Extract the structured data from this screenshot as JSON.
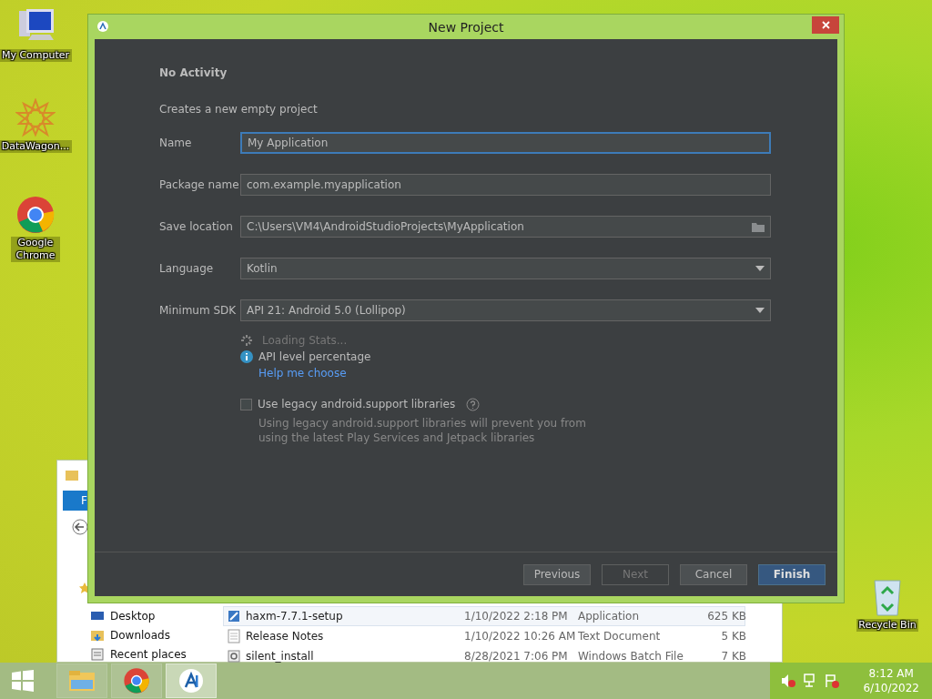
{
  "desktop_icons": [
    {
      "kind": "computer",
      "label": "My Computer"
    },
    {
      "kind": "star",
      "label": "DataWagon..."
    },
    {
      "kind": "browser",
      "label": "Google Chrome"
    }
  ],
  "recycle_bin": {
    "label": "Recycle Bin"
  },
  "explorer": {
    "ribbon_tab": "F",
    "nav_items": [
      {
        "kind": "desktop",
        "label": "Desktop"
      },
      {
        "kind": "downloads",
        "label": "Downloads"
      },
      {
        "kind": "recent",
        "label": "Recent places"
      }
    ],
    "files": [
      {
        "kind": "app",
        "name": "haxm-7.7.1-setup",
        "date": "1/10/2022 2:18 PM",
        "type": "Application",
        "size": "625 KB",
        "selected": true
      },
      {
        "kind": "text",
        "name": "Release Notes",
        "date": "1/10/2022 10:26 AM",
        "type": "Text Document",
        "size": "5 KB",
        "selected": false
      },
      {
        "kind": "batch",
        "name": "silent_install",
        "date": "8/28/2021 7:06 PM",
        "type": "Windows Batch File",
        "size": "7 KB",
        "selected": false
      }
    ]
  },
  "dialog": {
    "title": "New Project",
    "heading": "No Activity",
    "description": "Creates a new empty project",
    "fields": [
      {
        "kind": "text",
        "label": "Name",
        "value": "My Application",
        "focused": true
      },
      {
        "kind": "text",
        "label": "Package name",
        "value": "com.example.myapplication",
        "focused": false
      },
      {
        "kind": "folder",
        "label": "Save location",
        "value": "C:\\Users\\VM4\\AndroidStudioProjects\\MyApplication",
        "focused": false
      },
      {
        "kind": "dropdown",
        "label": "Language",
        "value": "Kotlin",
        "focused": false
      },
      {
        "kind": "dropdown",
        "label": "Minimum SDK",
        "value": "API 21: Android 5.0 (Lollipop)",
        "focused": false
      }
    ],
    "loading": "Loading Stats...",
    "info": "API level percentage",
    "link": "Help me choose",
    "legacy": {
      "label": "Use legacy android.support libraries",
      "checked": false,
      "hint": "Using legacy android.support libraries will prevent you from using the latest Play Services and Jetpack libraries"
    },
    "buttons": [
      {
        "label": "Previous",
        "disabled": false,
        "primary": false
      },
      {
        "label": "Next",
        "disabled": true,
        "primary": false
      },
      {
        "label": "Cancel",
        "disabled": false,
        "primary": false
      },
      {
        "label": "Finish",
        "disabled": false,
        "primary": true
      }
    ]
  },
  "taskbar": {
    "apps": [
      {
        "kind": "folder",
        "selected": false
      },
      {
        "kind": "browser",
        "selected": false
      },
      {
        "kind": "studio",
        "selected": true
      }
    ],
    "time": "8:12 AM",
    "date": "6/10/2022"
  }
}
